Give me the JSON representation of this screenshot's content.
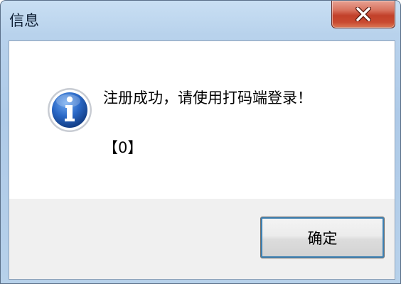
{
  "window": {
    "title": "信息",
    "close_icon": "close-icon"
  },
  "dialog": {
    "icon": "info-icon",
    "message": "注册成功，请使用打码端登录！",
    "code": "【0】",
    "ok_label": "确定"
  },
  "colors": {
    "titlebar_blue": "#b8d2ec",
    "close_red": "#c2402a",
    "info_blue": "#1f5fb8",
    "content_bg": "#ffffff",
    "button_area_bg": "#f0f0f0"
  }
}
